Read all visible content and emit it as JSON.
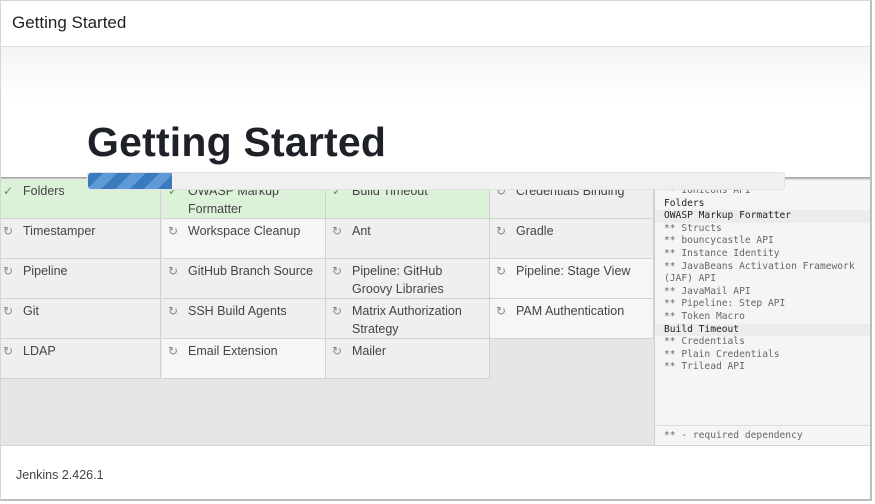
{
  "header": {
    "title": "Getting Started"
  },
  "main": {
    "title": "Getting Started",
    "progress": 0.12
  },
  "plugins": [
    {
      "label": "Folders",
      "status": "installed",
      "icon": "check-icon"
    },
    {
      "label": "OWASP Markup Formatter",
      "status": "installed",
      "icon": "check-icon"
    },
    {
      "label": "Build Timeout",
      "status": "installed",
      "icon": "check-icon"
    },
    {
      "label": "Credentials Binding",
      "status": "pending",
      "icon": "refresh-icon"
    },
    {
      "label": "Timestamper",
      "status": "pending",
      "icon": "refresh-icon"
    },
    {
      "label": "Workspace Cleanup",
      "status": "pending",
      "icon": "refresh-icon"
    },
    {
      "label": "Ant",
      "status": "pending",
      "icon": "refresh-icon"
    },
    {
      "label": "Gradle",
      "status": "pending",
      "icon": "refresh-icon"
    },
    {
      "label": "Pipeline",
      "status": "pending",
      "icon": "refresh-icon"
    },
    {
      "label": "GitHub Branch Source",
      "status": "pending",
      "icon": "refresh-icon"
    },
    {
      "label": "Pipeline: GitHub Groovy Libraries",
      "status": "pending",
      "icon": "refresh-icon"
    },
    {
      "label": "Pipeline: Stage View",
      "status": "pending",
      "icon": "refresh-icon"
    },
    {
      "label": "Git",
      "status": "pending",
      "icon": "refresh-icon"
    },
    {
      "label": "SSH Build Agents",
      "status": "pending",
      "icon": "refresh-icon"
    },
    {
      "label": "Matrix Authorization Strategy",
      "status": "pending",
      "icon": "refresh-icon"
    },
    {
      "label": "PAM Authentication",
      "status": "pending",
      "icon": "refresh-icon"
    },
    {
      "label": "LDAP",
      "status": "pending",
      "icon": "refresh-icon"
    },
    {
      "label": "Email Extension",
      "status": "pending",
      "icon": "refresh-icon"
    },
    {
      "label": "Mailer",
      "status": "pending",
      "icon": "refresh-icon"
    }
  ],
  "log": {
    "lines": [
      {
        "text": "** Ionicons API",
        "type": "dep"
      },
      {
        "text": "Folders",
        "type": "head"
      },
      {
        "text": "OWASP Markup Formatter",
        "type": "head"
      },
      {
        "text": "** Structs",
        "type": "dep"
      },
      {
        "text": "** bouncycastle API",
        "type": "dep"
      },
      {
        "text": "** Instance Identity",
        "type": "dep"
      },
      {
        "text": "** JavaBeans Activation Framework (JAF) API",
        "type": "dep"
      },
      {
        "text": "** JavaMail API",
        "type": "dep"
      },
      {
        "text": "** Pipeline: Step API",
        "type": "dep"
      },
      {
        "text": "** Token Macro",
        "type": "dep"
      },
      {
        "text": "Build Timeout",
        "type": "head"
      },
      {
        "text": "** Credentials",
        "type": "dep"
      },
      {
        "text": "** Plain Credentials",
        "type": "dep"
      },
      {
        "text": "** Trilead API",
        "type": "dep"
      }
    ],
    "footnote": "** - required dependency"
  },
  "footer": {
    "version": "Jenkins 2.426.1"
  }
}
